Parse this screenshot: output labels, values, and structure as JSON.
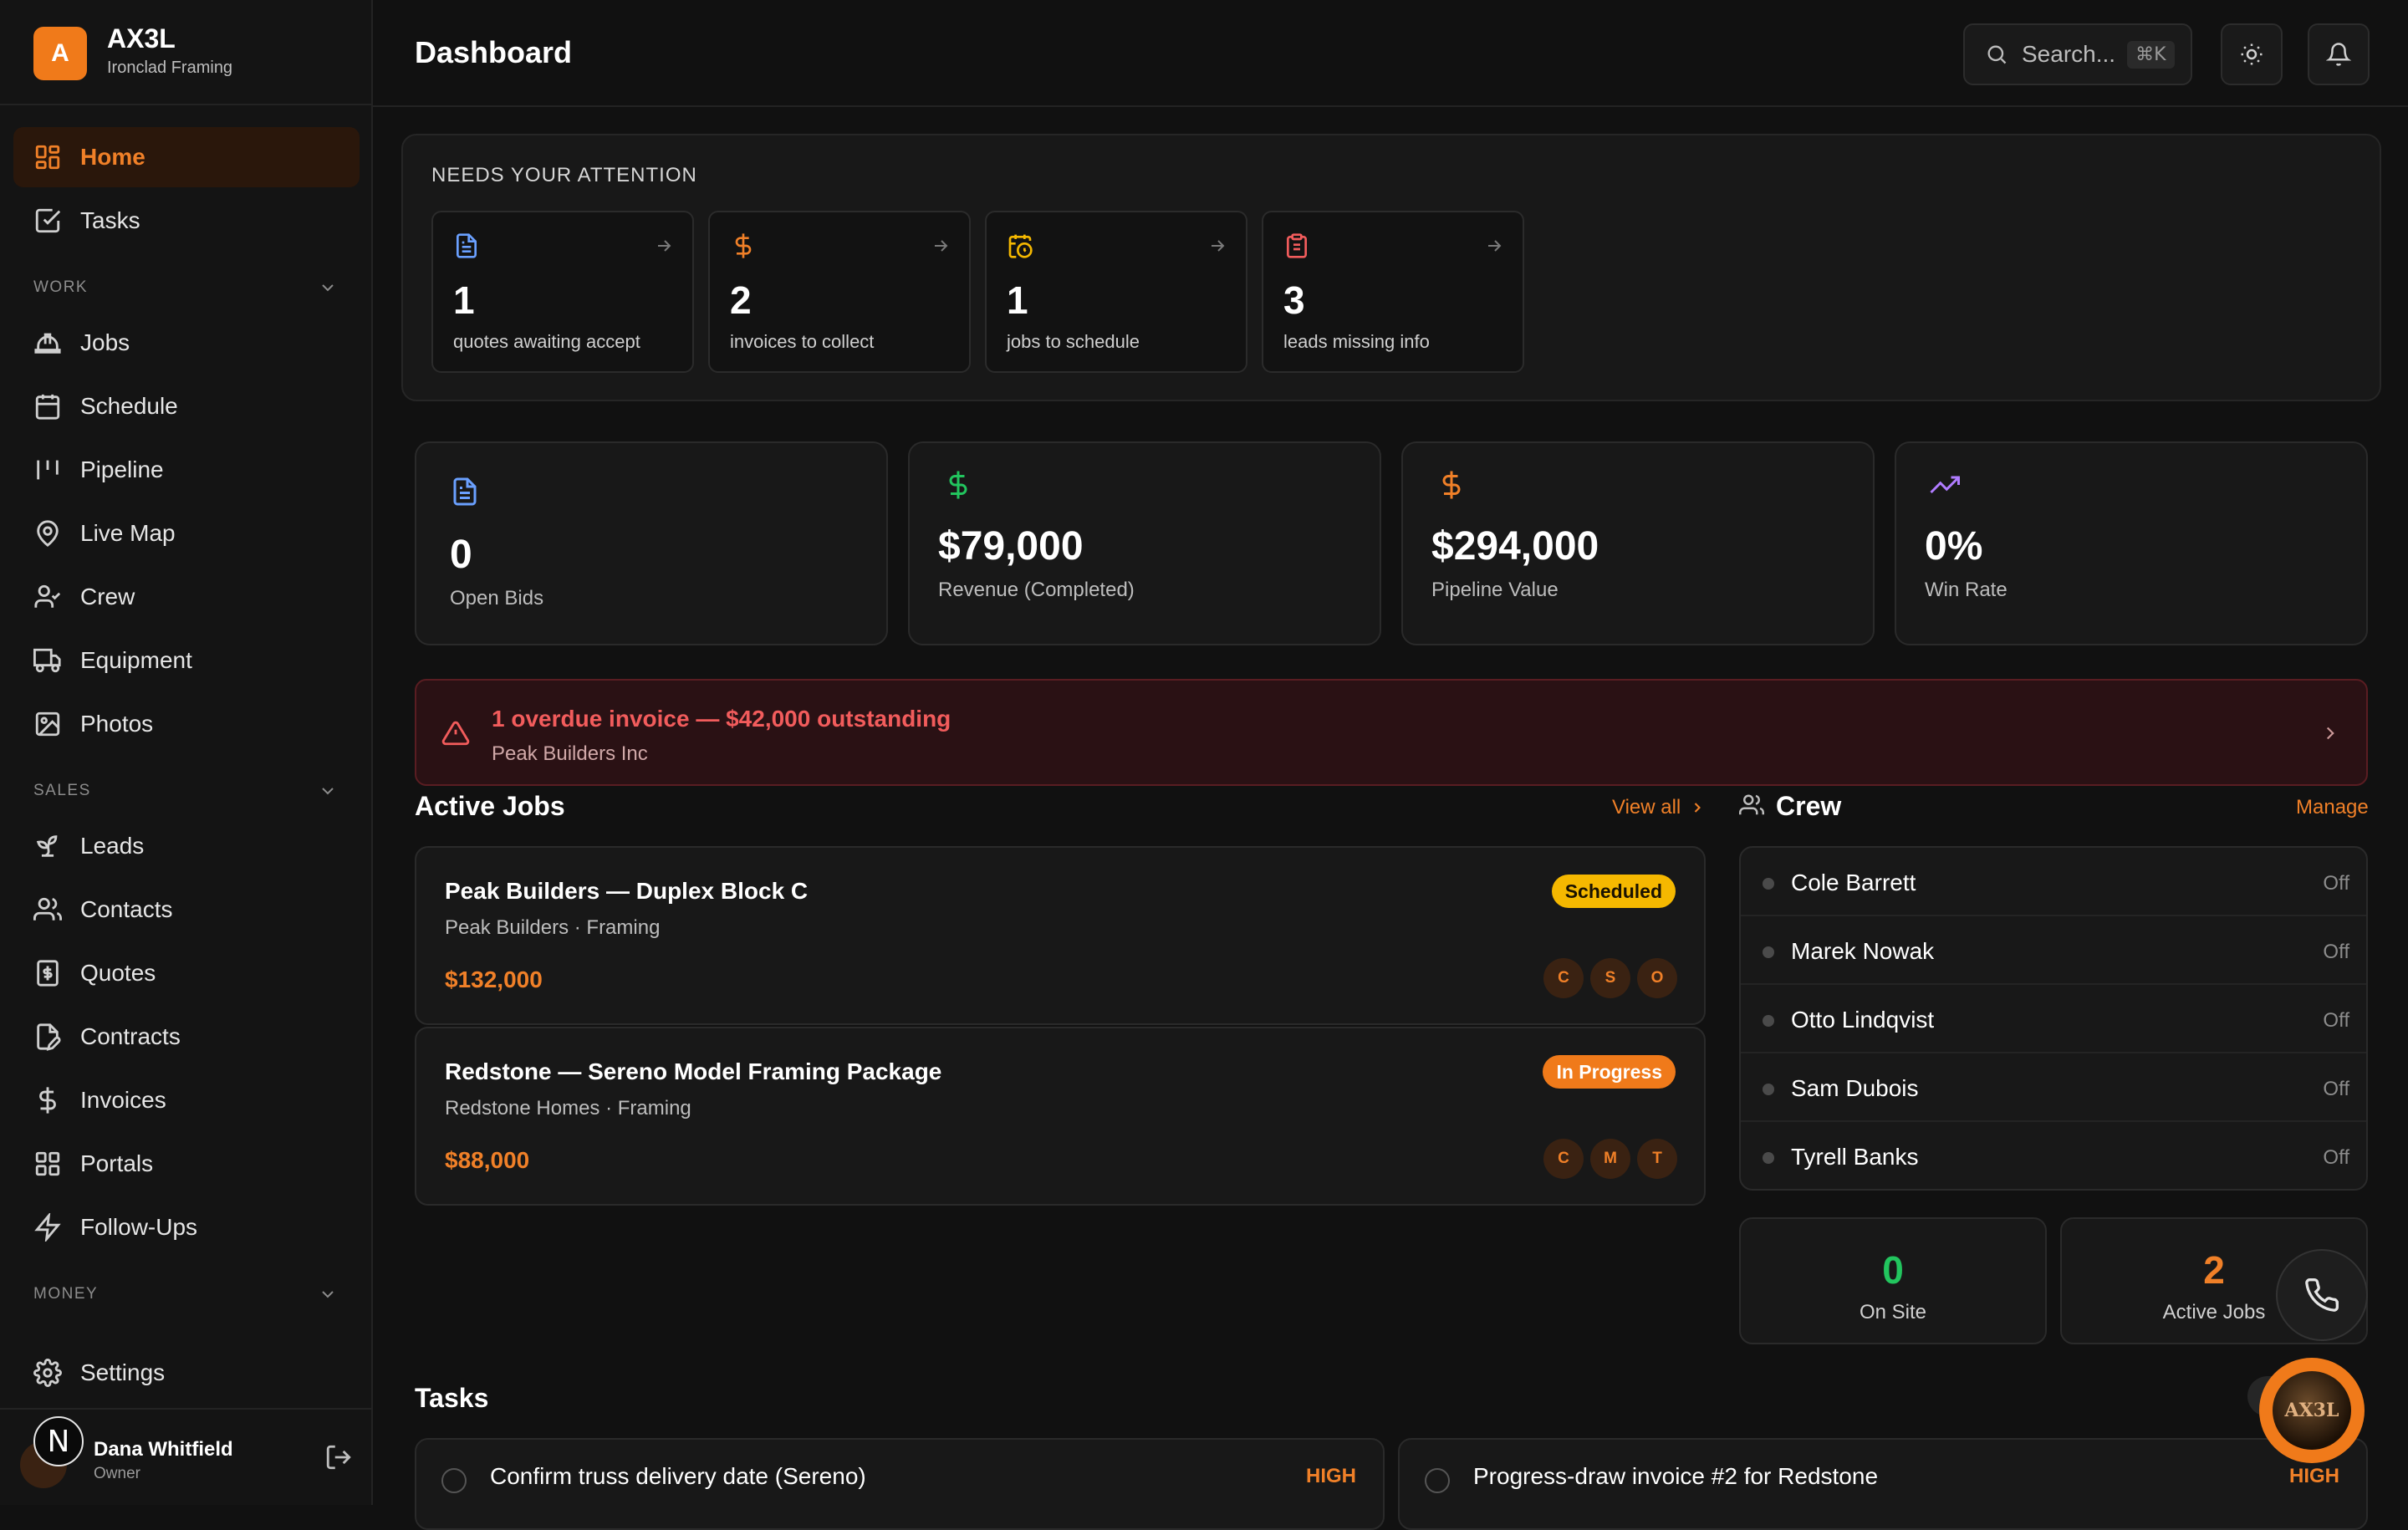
{
  "brand": {
    "logo_letter": "A",
    "name": "AX3L",
    "subtitle": "Ironclad Framing",
    "accent": "#f07a1a"
  },
  "sidebar": {
    "home": "Home",
    "tasks": "Tasks",
    "groups": {
      "work": "WORK",
      "sales": "SALES",
      "money": "MONEY"
    },
    "work_items": [
      "Jobs",
      "Schedule",
      "Pipeline",
      "Live Map",
      "Crew",
      "Equipment",
      "Photos"
    ],
    "sales_items": [
      "Leads",
      "Contacts",
      "Quotes",
      "Contracts",
      "Invoices",
      "Portals",
      "Follow-Ups"
    ],
    "settings": "Settings",
    "user": {
      "initial": "N",
      "name": "Dana Whitfield",
      "role": "Owner"
    }
  },
  "header": {
    "title": "Dashboard",
    "search_placeholder": "Search...",
    "search_shortcut": "⌘K"
  },
  "attention": {
    "title": "NEEDS YOUR ATTENTION",
    "cards": [
      {
        "count": "1",
        "label": "quotes awaiting accept",
        "icon": "document-icon",
        "color": "#6aa0ff"
      },
      {
        "count": "2",
        "label": "invoices to collect",
        "icon": "dollar-icon",
        "color": "#f08028"
      },
      {
        "count": "1",
        "label": "jobs to schedule",
        "icon": "calendar-clock-icon",
        "color": "#f5b800"
      },
      {
        "count": "3",
        "label": "leads missing info",
        "icon": "clipboard-icon",
        "color": "#f25c5c"
      }
    ]
  },
  "stats": [
    {
      "value": "0",
      "label": "Open Bids",
      "icon": "document-icon",
      "color": "#6aa0ff"
    },
    {
      "value": "$79,000",
      "label": "Revenue (Completed)",
      "icon": "dollar-icon",
      "color": "#22c55e"
    },
    {
      "value": "$294,000",
      "label": "Pipeline Value",
      "icon": "dollar-icon",
      "color": "#f08028"
    },
    {
      "value": "0%",
      "label": "Win Rate",
      "icon": "trending-up-icon",
      "color": "#b07cff"
    }
  ],
  "alert": {
    "title": "1 overdue invoice — $42,000 outstanding",
    "subtitle": "Peak Builders Inc"
  },
  "active_jobs": {
    "title": "Active Jobs",
    "view_all": "View all",
    "jobs": [
      {
        "title": "Peak Builders — Duplex Block C",
        "subtitle": "Peak Builders · Framing",
        "value": "$132,000",
        "status": "Scheduled",
        "crew": [
          "C",
          "S",
          "O"
        ]
      },
      {
        "title": "Redstone — Sereno Model Framing Package",
        "subtitle": "Redstone Homes · Framing",
        "value": "$88,000",
        "status": "In Progress",
        "crew": [
          "C",
          "M",
          "T"
        ]
      }
    ]
  },
  "crew": {
    "title": "Crew",
    "manage": "Manage",
    "members": [
      {
        "name": "Cole Barrett",
        "status": "Off"
      },
      {
        "name": "Marek Nowak",
        "status": "Off"
      },
      {
        "name": "Otto Lindqvist",
        "status": "Off"
      },
      {
        "name": "Sam Dubois",
        "status": "Off"
      },
      {
        "name": "Tyrell Banks",
        "status": "Off"
      }
    ],
    "on_site": {
      "value": "0",
      "label": "On Site",
      "color": "#22c55e"
    },
    "active_jobs": {
      "value": "2",
      "label": "Active Jobs",
      "color": "#f08028"
    }
  },
  "tasks": {
    "title": "Tasks",
    "items": [
      {
        "title": "Confirm truss delivery date (Sereno)",
        "priority": "HIGH"
      },
      {
        "title": "Progress-draw invoice #2 for Redstone",
        "priority": "HIGH"
      }
    ]
  },
  "assistant": {
    "label": "AX3L"
  }
}
